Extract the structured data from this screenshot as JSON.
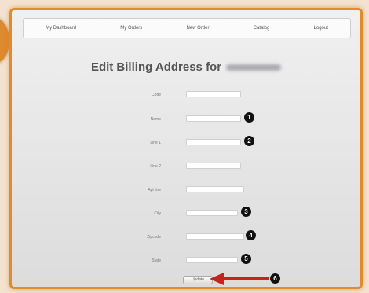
{
  "nav": {
    "items": [
      "My Dashboard",
      "My Orders",
      "New Order",
      "Catalog",
      "Logout"
    ]
  },
  "page": {
    "title": "Edit Billing Address for"
  },
  "form": {
    "fields": [
      {
        "label": "Code",
        "value": "",
        "badge": ""
      },
      {
        "label": "Name",
        "value": "",
        "badge": "1"
      },
      {
        "label": "Line 1",
        "value": "",
        "badge": "2"
      },
      {
        "label": "Line 2",
        "value": "",
        "badge": ""
      },
      {
        "label": "Apt line",
        "value": "",
        "badge": ""
      },
      {
        "label": "City",
        "value": "",
        "badge": "3"
      },
      {
        "label": "Zipcode",
        "value": "",
        "badge": "4"
      },
      {
        "label": "State",
        "value": "",
        "badge": "5"
      }
    ],
    "save_label": "Update",
    "save_badge": "6"
  },
  "colors": {
    "frame": "#de8c2c",
    "arrow": "#c4241e",
    "badge": "#111111"
  }
}
